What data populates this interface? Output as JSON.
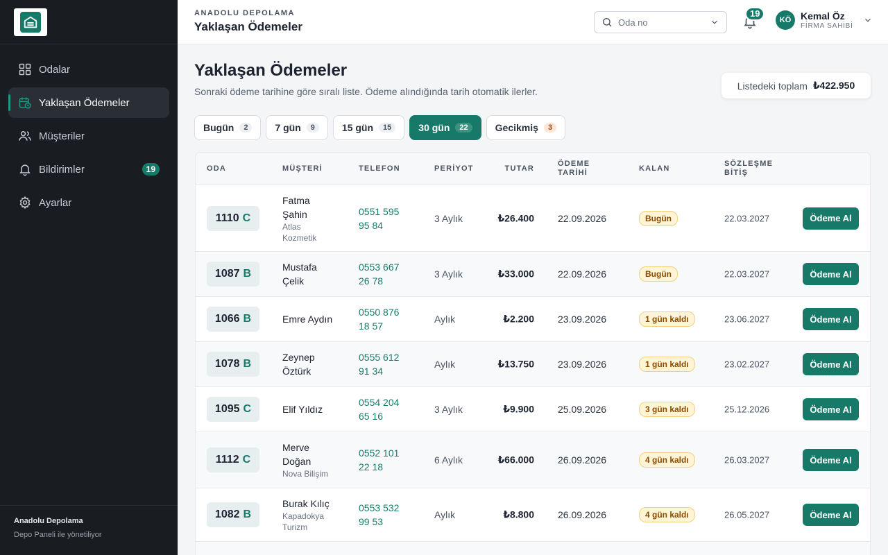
{
  "sidebar": {
    "items": [
      {
        "label": "Odalar",
        "icon": "grid-icon"
      },
      {
        "label": "Yaklaşan Ödemeler",
        "icon": "calendar-clock-icon"
      },
      {
        "label": "Müşteriler",
        "icon": "users-icon"
      },
      {
        "label": "Bildirimler",
        "icon": "bell-icon",
        "badge": "19"
      },
      {
        "label": "Ayarlar",
        "icon": "gear-icon"
      }
    ],
    "footer_title": "Anadolu Depolama",
    "footer_sub": "Depo Paneli ile yönetiliyor"
  },
  "header": {
    "eyebrow": "ANADOLU DEPOLAMA",
    "title": "Yaklaşan Ödemeler",
    "search_placeholder": "Oda no",
    "notif_count": "19",
    "user_initials": "KÖ",
    "user_name": "Kemal Öz",
    "user_role": "FİRMA SAHİBİ"
  },
  "main": {
    "title": "Yaklaşan Ödemeler",
    "subtitle": "Sonraki ödeme tarihine göre sıralı liste. Ödeme alındığında tarih otomatik ilerler.",
    "total_label": "Listedeki toplam",
    "total_value": "₺422.950",
    "filters": [
      {
        "label": "Bugün",
        "count": "2"
      },
      {
        "label": "7 gün",
        "count": "9"
      },
      {
        "label": "15 gün",
        "count": "15"
      },
      {
        "label": "30 gün",
        "count": "22"
      },
      {
        "label": "Gecikmiş",
        "count": "3"
      }
    ]
  },
  "table": {
    "headers": {
      "room": "ODA",
      "customer": "MÜŞTERİ",
      "phone": "TELEFON",
      "period": "PERİYOT",
      "amount": "TUTAR",
      "due_l1": "ÖDEME",
      "due_l2": "TARİHİ",
      "remaining": "KALAN",
      "end_l1": "SÖZLEŞME",
      "end_l2": "BİTİŞ"
    },
    "action_label": "Ödeme Al",
    "rows": [
      {
        "room": "1110",
        "block": "C",
        "name_l1": "Fatma",
        "name_l2": "Şahin",
        "co_l1": "Atlas",
        "co_l2": "Kozmetik",
        "phone_l1": "0551 595",
        "phone_l2": "95 84",
        "period": "3 Aylık",
        "amount": "₺26.400",
        "due": "22.09.2026",
        "remaining": "Bugün",
        "end": "22.03.2027"
      },
      {
        "room": "1087",
        "block": "B",
        "name_l1": "Mustafa",
        "name_l2": "Çelik",
        "co_l1": "",
        "co_l2": "",
        "phone_l1": "0553 667",
        "phone_l2": "26 78",
        "period": "3 Aylık",
        "amount": "₺33.000",
        "due": "22.09.2026",
        "remaining": "Bugün",
        "end": "22.03.2027"
      },
      {
        "room": "1066",
        "block": "B",
        "name_l1": "Emre Aydın",
        "name_l2": "",
        "co_l1": "",
        "co_l2": "",
        "phone_l1": "0550 876",
        "phone_l2": "18 57",
        "period": "Aylık",
        "amount": "₺2.200",
        "due": "23.09.2026",
        "remaining": "1 gün kaldı",
        "end": "23.06.2027"
      },
      {
        "room": "1078",
        "block": "B",
        "name_l1": "Zeynep",
        "name_l2": "Öztürk",
        "co_l1": "",
        "co_l2": "",
        "phone_l1": "0555 612",
        "phone_l2": "91 34",
        "period": "Aylık",
        "amount": "₺13.750",
        "due": "23.09.2026",
        "remaining": "1 gün kaldı",
        "end": "23.02.2027"
      },
      {
        "room": "1095",
        "block": "C",
        "name_l1": "Elif Yıldız",
        "name_l2": "",
        "co_l1": "",
        "co_l2": "",
        "phone_l1": "0554 204",
        "phone_l2": "65 16",
        "period": "3 Aylık",
        "amount": "₺9.900",
        "due": "25.09.2026",
        "remaining": "3 gün kaldı",
        "end": "25.12.2026"
      },
      {
        "room": "1112",
        "block": "C",
        "name_l1": "Merve",
        "name_l2": "Doğan",
        "co_l1": "Nova Bilişim",
        "co_l2": "",
        "phone_l1": "0552 101",
        "phone_l2": "22 18",
        "period": "6 Aylık",
        "amount": "₺66.000",
        "due": "26.09.2026",
        "remaining": "4 gün kaldı",
        "end": "26.03.2027"
      },
      {
        "room": "1082",
        "block": "B",
        "name_l1": "Burak Kılıç",
        "name_l2": "",
        "co_l1": "Kapadokya",
        "co_l2": "Turizm",
        "phone_l1": "0553 532",
        "phone_l2": "99 53",
        "period": "Aylık",
        "amount": "₺8.800",
        "due": "26.09.2026",
        "remaining": "4 gün kaldı",
        "end": "26.05.2027"
      }
    ]
  }
}
